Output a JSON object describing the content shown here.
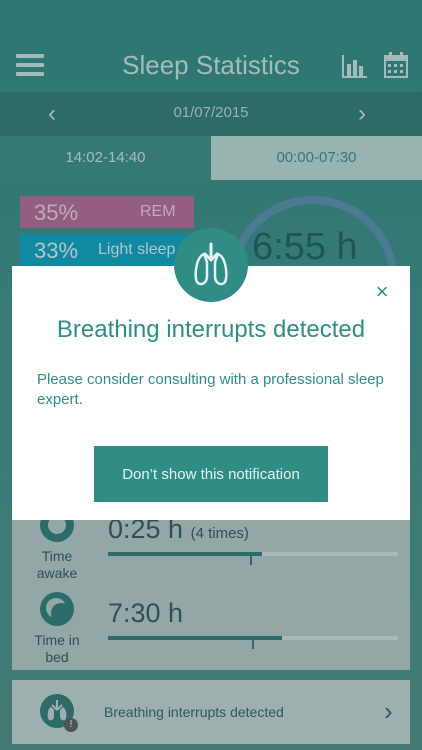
{
  "header": {
    "title": "Sleep Statistics",
    "menu_icon": "menu-icon",
    "chart_icon": "bar-chart-icon",
    "calendar_icon": "calendar-icon"
  },
  "datebar": {
    "date": "01/07/2015",
    "prev": "‹",
    "next": "›"
  },
  "tabs": [
    {
      "label": "14:02-14:40"
    },
    {
      "label": "00:00-07:30"
    }
  ],
  "stats": {
    "rem": {
      "percent": "35%",
      "label": "REM"
    },
    "light": {
      "percent": "33%",
      "label": "Light sleep"
    },
    "duration": "6:55 h"
  },
  "rows": {
    "awake": {
      "label_line1": "Time",
      "label_line2": "awake",
      "value": "0:25 h",
      "note": "(4 times)",
      "fill": 0.53
    },
    "bed": {
      "label_line1": "Time in",
      "label_line2": "bed",
      "value": "7:30 h",
      "fill": 0.6
    }
  },
  "footer": {
    "text": "Breathing interrupts detected",
    "badge": "!"
  },
  "modal": {
    "title": "Breathing interrupts detected",
    "body": "Please consider consulting with a professional sleep expert.",
    "button": "Don’t show this notification",
    "close": "×"
  },
  "colors": {
    "accent": "#2f8d86",
    "rem": "#b76a96",
    "light": "#0aa3c2"
  }
}
